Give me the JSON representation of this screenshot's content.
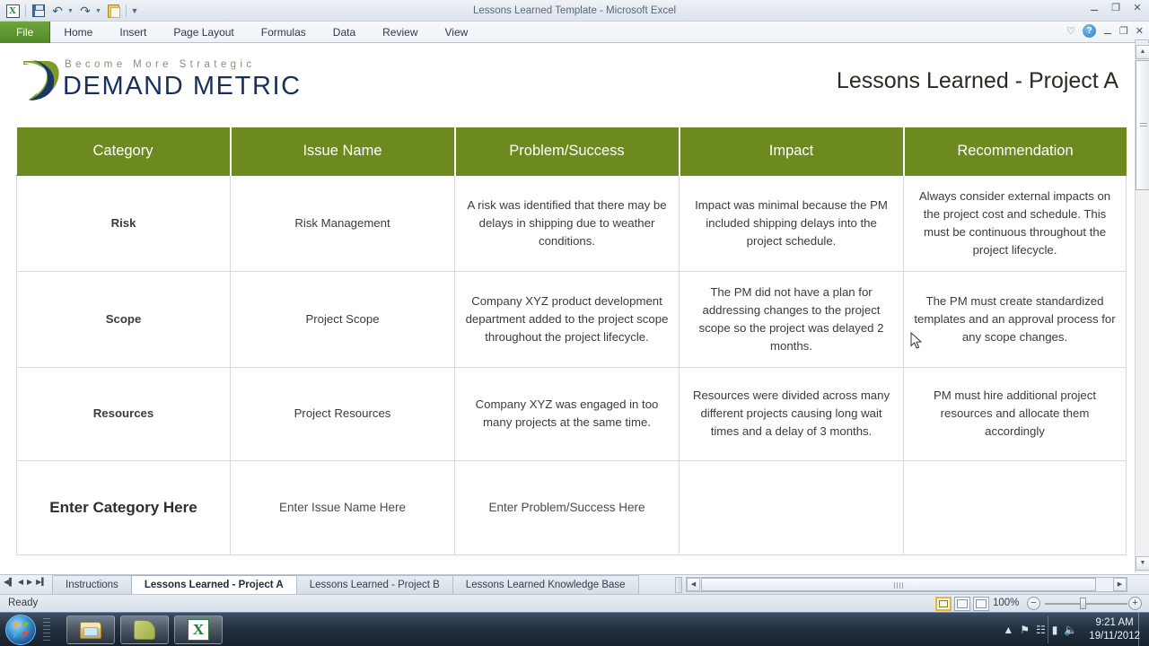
{
  "window": {
    "title": "Lessons Learned Template  -  Microsoft Excel",
    "quick_access": [
      {
        "name": "excel-icon",
        "label": "X"
      },
      {
        "name": "save-icon",
        "label": ""
      },
      {
        "name": "undo-icon",
        "label": "↶"
      },
      {
        "name": "redo-icon",
        "label": "↷"
      },
      {
        "name": "clipboard-icon",
        "label": ""
      },
      {
        "name": "customize-qat-icon",
        "label": "▾"
      }
    ],
    "controls": {
      "minimize": "–",
      "restore": "❐",
      "close": "✕"
    },
    "ribbon_controls": {
      "shape": "♡",
      "help": "?",
      "minimize": "–",
      "restore": "❐",
      "close": "✕"
    }
  },
  "ribbon": {
    "tabs": [
      {
        "label": "File",
        "active": true
      },
      {
        "label": "Home",
        "active": false
      },
      {
        "label": "Insert",
        "active": false
      },
      {
        "label": "Page Layout",
        "active": false
      },
      {
        "label": "Formulas",
        "active": false
      },
      {
        "label": "Data",
        "active": false
      },
      {
        "label": "Review",
        "active": false
      },
      {
        "label": "View",
        "active": false
      }
    ]
  },
  "sheet": {
    "brand": {
      "tagline": "Become More Strategic",
      "name": "DEMAND METRIC"
    },
    "doc_title": "Lessons Learned - Project A",
    "table": {
      "headers": [
        "Category",
        "Issue Name",
        "Problem/Success",
        "Impact",
        "Recommendation"
      ],
      "rows": [
        {
          "category": "Risk",
          "issue": "Risk Management",
          "problem": "A risk was identified that there may be delays in shipping due to weather conditions.",
          "impact": "Impact was minimal because the PM included shipping delays into the project schedule.",
          "recommendation": "Always consider external impacts on the project cost and schedule. This must be continuous throughout the project lifecycle."
        },
        {
          "category": "Scope",
          "issue": "Project Scope",
          "problem": "Company XYZ product development department added to the project scope throughout the project lifecycle.",
          "impact": "The PM did not have a plan for addressing changes to the project scope so the project was delayed 2 months.",
          "recommendation": "The PM must create standardized templates and an approval process for any scope changes."
        },
        {
          "category": "Resources",
          "issue": "Project Resources",
          "problem": "Company XYZ was engaged in too many projects at the same time.",
          "impact": "Resources were divided across many different projects causing long wait times and a delay of 3 months.",
          "recommendation": "PM must hire additional project resources and allocate them accordingly"
        },
        {
          "category": "Enter Category Here",
          "issue": "Enter Issue Name Here",
          "problem": "Enter Problem/Success Here",
          "impact": "",
          "recommendation": ""
        }
      ]
    },
    "header_color": "#6c8a1e",
    "brand_color": "#17315c"
  },
  "sheet_tabs": {
    "nav": [
      "◀▏",
      "◀",
      "▶",
      "▶▕"
    ],
    "items": [
      {
        "label": "Instructions",
        "active": false
      },
      {
        "label": "Lessons Learned - Project A",
        "active": true
      },
      {
        "label": "Lessons Learned - Project B",
        "active": false
      },
      {
        "label": "Lessons Learned Knowledge Base",
        "active": false
      }
    ],
    "hscroll": {
      "left": "◀",
      "right": "▶"
    }
  },
  "status_bar": {
    "state": "Ready",
    "view_buttons": [
      "normal-view",
      "page-layout-view",
      "page-break-view"
    ],
    "zoom": "100%",
    "zoom_out": "−",
    "zoom_in": "+"
  },
  "taskbar": {
    "start": "start-orb",
    "apps": [
      {
        "name": "windows-explorer",
        "icon": "folder-icon"
      },
      {
        "name": "sticky-notes",
        "icon": "note-icon"
      },
      {
        "name": "microsoft-excel",
        "icon": "excel-icon",
        "label": "X"
      }
    ],
    "tray": [
      "▴",
      "⌗",
      "⚐",
      "▮",
      "◂))"
    ],
    "clock_time": "9:21 AM",
    "clock_date": "19/11/2012"
  }
}
